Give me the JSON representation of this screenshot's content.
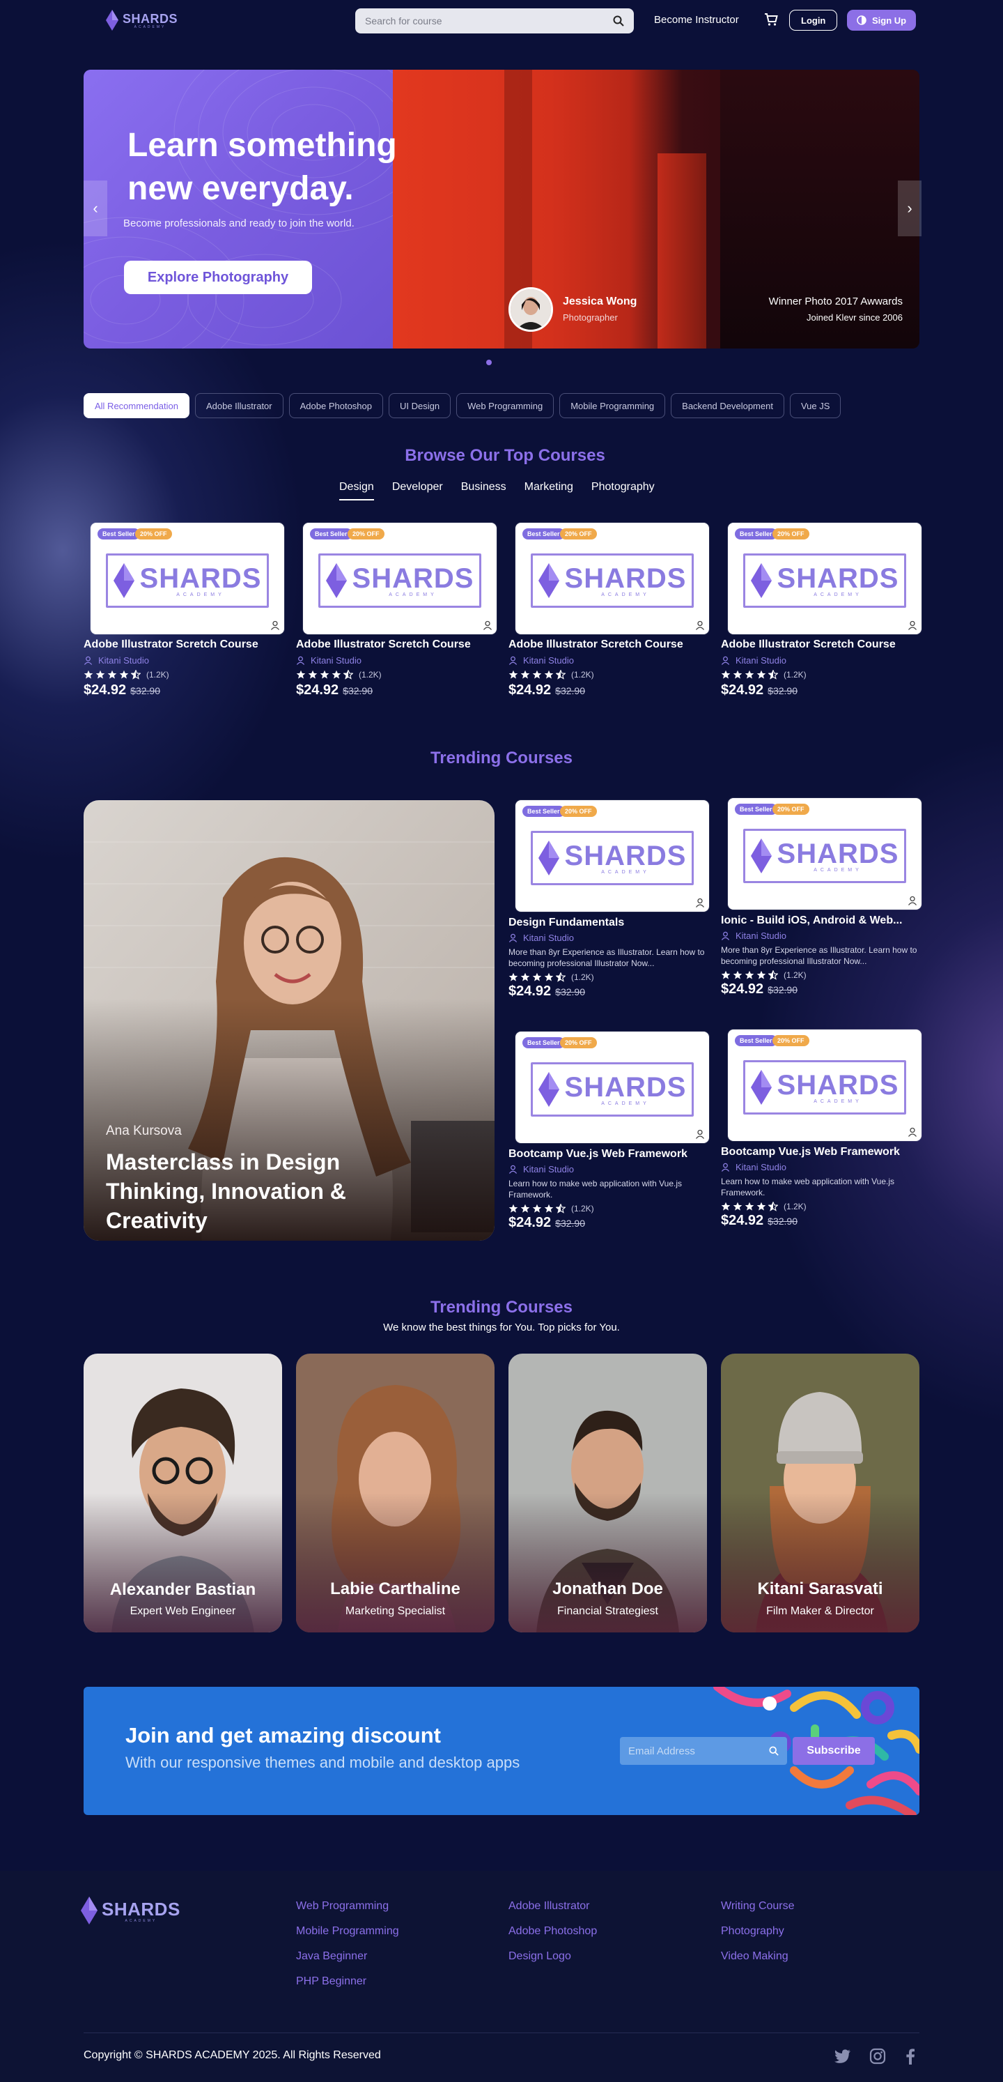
{
  "header": {
    "logo_text": "SHARDS",
    "logo_sub": "ACADEMY",
    "search_placeholder": "Search for course",
    "become_instructor": "Become Instructor",
    "login": "Login",
    "signup": "Sign Up"
  },
  "hero": {
    "title": "Learn something new everyday.",
    "subtitle": "Become professionals and ready to join the world.",
    "cta": "Explore Photography",
    "person_name": "Jessica Wong",
    "person_role": "Photographer",
    "award_line1": "Winner Photo 2017 Awwards",
    "award_line2": "Joined Klevr since 2006",
    "prev_arrow": "‹",
    "next_arrow": "›"
  },
  "chips": [
    "All Recommendation",
    "Adobe Illustrator",
    "Adobe Photoshop",
    "UI Design",
    "Web Programming",
    "Mobile Programming",
    "Backend Development",
    "Vue JS"
  ],
  "top_courses": {
    "title": "Browse Our Top Courses",
    "tabs": [
      "Design",
      "Developer",
      "Business",
      "Marketing",
      "Photography"
    ],
    "cards": [
      {
        "best": "Best Seller",
        "off": "20% OFF",
        "title": "Adobe Illustrator Scretch Course",
        "author": "Kitani Studio",
        "rating_count": "(1.2K)",
        "price": "$24.92",
        "old_price": "$32.90"
      },
      {
        "best": "Best Seller",
        "off": "20% OFF",
        "title": "Adobe Illustrator Scretch Course",
        "author": "Kitani Studio",
        "rating_count": "(1.2K)",
        "price": "$24.92",
        "old_price": "$32.90"
      },
      {
        "best": "Best Seller",
        "off": "20% OFF",
        "title": "Adobe Illustrator Scretch Course",
        "author": "Kitani Studio",
        "rating_count": "(1.2K)",
        "price": "$24.92",
        "old_price": "$32.90"
      },
      {
        "best": "Best Seller",
        "off": "20% OFF",
        "title": "Adobe Illustrator Scretch Course",
        "author": "Kitani Studio",
        "rating_count": "(1.2K)",
        "price": "$24.92",
        "old_price": "$32.90"
      }
    ]
  },
  "trending": {
    "title": "Trending Courses",
    "feature_author": "Ana Kursova",
    "feature_title": "Masterclass in Design Thinking, Innovation & Creativity",
    "cards": [
      {
        "best": "Best Seller",
        "off": "20% OFF",
        "title": "Design Fundamentals",
        "author": "Kitani Studio",
        "desc": "More than 8yr Experience as Illustrator. Learn how to becoming professional Illustrator Now...",
        "rating_count": "(1.2K)",
        "price": "$24.92",
        "old_price": "$32.90"
      },
      {
        "best": "Best Seller",
        "off": "20% OFF",
        "title": "Ionic - Build iOS, Android & Web...",
        "author": "Kitani Studio",
        "desc": "More than 8yr Experience as Illustrator. Learn how to becoming professional Illustrator Now...",
        "rating_count": "(1.2K)",
        "price": "$24.92",
        "old_price": "$32.90"
      },
      {
        "best": "Best Seller",
        "off": "20% OFF",
        "title": "Bootcamp  Vue.js Web Framework",
        "author": "Kitani Studio",
        "desc": "Learn how to make web application with Vue.js Framework.",
        "rating_count": "(1.2K)",
        "price": "$24.92",
        "old_price": "$32.90"
      },
      {
        "best": "Best Seller",
        "off": "20% OFF",
        "title": "Bootcamp  Vue.js Web Framework",
        "author": "Kitani Studio",
        "desc": "Learn how to make web application with Vue.js Framework.",
        "rating_count": "(1.2K)",
        "price": "$24.92",
        "old_price": "$32.90"
      }
    ]
  },
  "instructors": {
    "title": "Trending Courses",
    "subtitle": "We know the best things for You.  Top picks for You.",
    "people": [
      {
        "name": "Alexander Bastian",
        "role": "Expert Web Engineer"
      },
      {
        "name": "Labie Carthaline",
        "role": "Marketing Specialist"
      },
      {
        "name": "Jonathan Doe",
        "role": "Financial Strategiest"
      },
      {
        "name": "Kitani Sarasvati",
        "role": "Film Maker & Director"
      }
    ]
  },
  "join": {
    "title": "Join and get amazing discount",
    "subtitle": "With our responsive themes and mobile and desktop apps",
    "email_placeholder": "Email Address",
    "subscribe": "Subscribe"
  },
  "footer": {
    "logo_text": "SHARDS",
    "logo_sub": "ACADEMY",
    "col1": [
      "Web Programming",
      "Mobile Programming",
      "Java Beginner",
      "PHP Beginner"
    ],
    "col2": [
      "Adobe Illustrator",
      "Adobe Photoshop",
      "Design Logo"
    ],
    "col3": [
      "Writing Course",
      "Photography",
      "Video Making"
    ],
    "copyright": "Copyright © SHARDS ACADEMY 2025. All Rights Reserved"
  },
  "colors": {
    "background": "#0b1038",
    "accent": "#8c70ea",
    "join_banner": "#2472d8"
  },
  "icons": [
    "search-icon",
    "cart-icon",
    "theme-toggle-icon",
    "user-icon",
    "star-icon",
    "twitter-icon",
    "instagram-icon",
    "facebook-icon"
  ]
}
